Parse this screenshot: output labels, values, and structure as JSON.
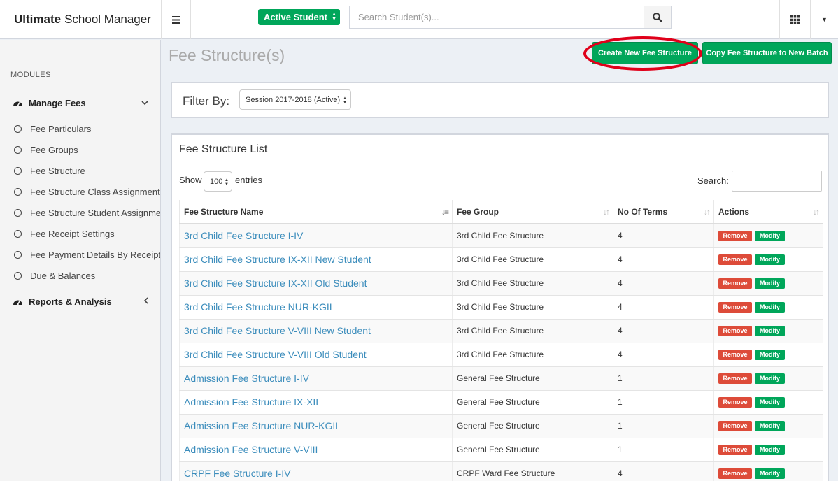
{
  "app": {
    "brand_bold": "Ultimate",
    "brand_rest": "School Manager"
  },
  "topbar": {
    "student_filter": "Active Student",
    "search_placeholder": "Search Student(s)..."
  },
  "sidebar": {
    "modules_label": "MODULES",
    "manage_fees": "Manage Fees",
    "items": [
      {
        "label": "Fee Particulars"
      },
      {
        "label": "Fee Groups"
      },
      {
        "label": "Fee Structure"
      },
      {
        "label": "Fee Structure Class Assignment"
      },
      {
        "label": "Fee Structure Student Assignment"
      },
      {
        "label": "Fee Receipt Settings"
      },
      {
        "label": "Fee Payment Details By Receipt No"
      },
      {
        "label": "Due & Balances"
      }
    ],
    "reports": "Reports & Analysis"
  },
  "page": {
    "title": "Fee Structure(s)",
    "create_button": "Create New Fee Structure",
    "copy_button": "Copy Fee Structure to New Batch"
  },
  "filter": {
    "label": "Filter By:",
    "session_value": "Session 2017-2018 (Active)"
  },
  "list": {
    "title": "Fee Structure List",
    "show_label": "Show",
    "entries_value": "100",
    "entries_label": "entries",
    "search_label": "Search:",
    "columns": [
      "Fee Structure Name",
      "Fee Group",
      "No Of Terms",
      "Actions"
    ],
    "remove_label": "Remove",
    "modify_label": "Modify",
    "rows": [
      {
        "name": "3rd Child Fee Structure I-IV",
        "group": "3rd Child Fee Structure",
        "terms": "4"
      },
      {
        "name": "3rd Child Fee Structure IX-XII New Student",
        "group": "3rd Child Fee Structure",
        "terms": "4"
      },
      {
        "name": "3rd Child Fee Structure IX-XII Old Student",
        "group": "3rd Child Fee Structure",
        "terms": "4"
      },
      {
        "name": "3rd Child Fee Structure NUR-KGII",
        "group": "3rd Child Fee Structure",
        "terms": "4"
      },
      {
        "name": "3rd Child Fee Structure V-VIII New Student",
        "group": "3rd Child Fee Structure",
        "terms": "4"
      },
      {
        "name": "3rd Child Fee Structure V-VIII Old Student",
        "group": "3rd Child Fee Structure",
        "terms": "4"
      },
      {
        "name": "Admission Fee Structure I-IV",
        "group": "General Fee Structure",
        "terms": "1"
      },
      {
        "name": "Admission Fee Structure IX-XII",
        "group": "General Fee Structure",
        "terms": "1"
      },
      {
        "name": "Admission Fee Structure NUR-KGII",
        "group": "General Fee Structure",
        "terms": "1"
      },
      {
        "name": "Admission Fee Structure V-VIII",
        "group": "General Fee Structure",
        "terms": "1"
      },
      {
        "name": "CRPF Fee Structure I-IV",
        "group": "CRPF Ward Fee Structure",
        "terms": "4"
      }
    ]
  },
  "colors": {
    "accent_green": "#00a65a",
    "danger_red": "#dd4b39",
    "link_blue": "#3c8dbc",
    "highlight_ring": "#e0001a"
  }
}
